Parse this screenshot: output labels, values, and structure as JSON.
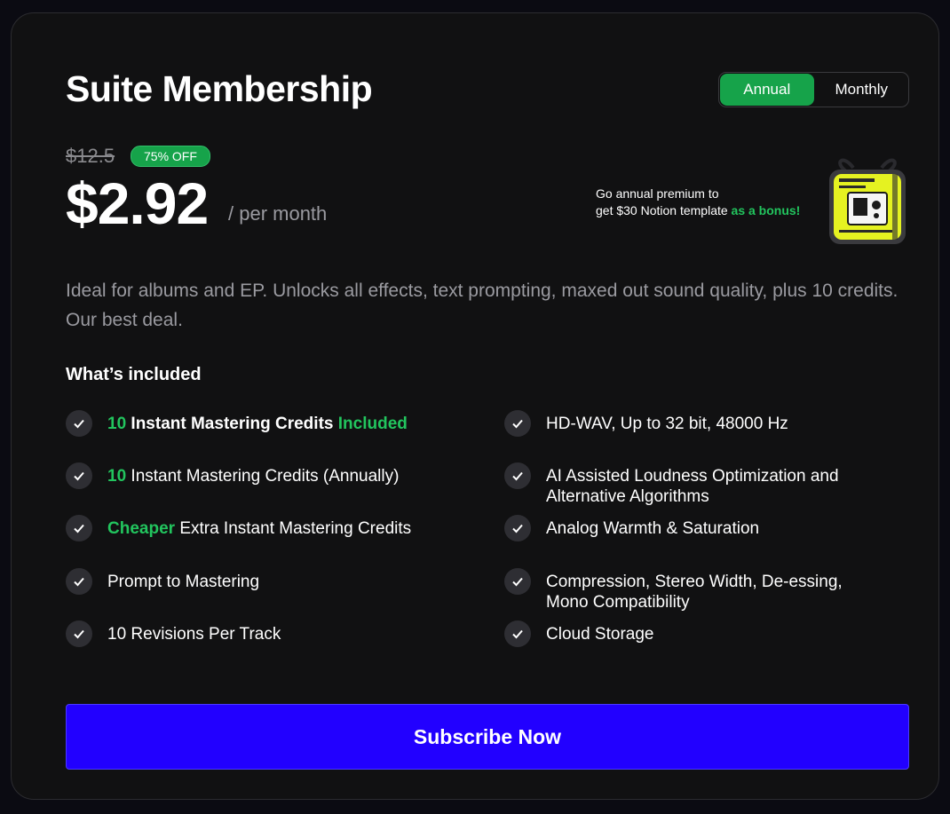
{
  "plan": {
    "title": "Suite Membership",
    "billing_options": [
      "Annual",
      "Monthly"
    ],
    "selected_billing": "Annual",
    "old_price": "$12.5",
    "discount_badge": "75% OFF",
    "price": "$2.92",
    "price_period": "/ per month",
    "bonus": {
      "line1": "Go annual premium to",
      "line2_prefix": "get $30 Notion template",
      "line2_highlight": "as a bonus!"
    },
    "description": "Ideal for albums and EP. Unlocks all effects, text prompting, maxed out sound quality, plus 10 credits. Our best deal.",
    "included_heading": "What’s included"
  },
  "features_left": [
    {
      "highlight": "10",
      "text": "Instant Mastering Credits",
      "suffix": "Included"
    },
    {
      "highlight": "10",
      "text": "Instant Mastering Credits (Annually)",
      "suffix": ""
    },
    {
      "highlight": "Cheaper",
      "text": "Extra Instant Mastering Credits",
      "suffix": ""
    },
    {
      "highlight": "",
      "text": "Prompt to Mastering",
      "suffix": ""
    },
    {
      "highlight": "",
      "text": "10 Revisions Per Track",
      "suffix": ""
    }
  ],
  "features_right": [
    "HD-WAV, Up to 32 bit, 48000 Hz",
    "AI Assisted Loudness Optimization and Alternative Algorithms",
    "Analog Warmth & Saturation",
    "Compression, Stereo Width, De-essing, Mono Compatibility",
    "Cloud Storage"
  ],
  "cta": {
    "label": "Subscribe Now"
  },
  "colors": {
    "accent_green": "#16a34a",
    "highlight_green": "#22c55e",
    "cta_blue": "#2200ff",
    "card_bg": "#111112"
  },
  "icons": {
    "feature": "check-icon",
    "bonus": "gift-box-icon"
  }
}
